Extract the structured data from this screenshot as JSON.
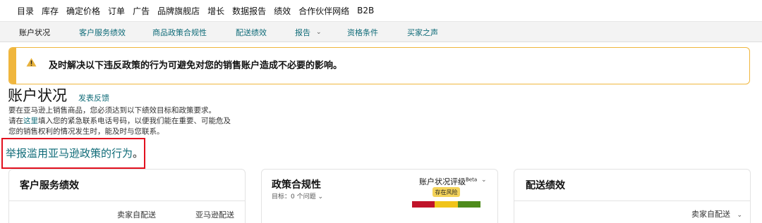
{
  "top_nav": {
    "items": [
      "目录",
      "库存",
      "确定价格",
      "订单",
      "广告",
      "品牌旗舰店",
      "增长",
      "数据报告",
      "绩效",
      "合作伙伴网络",
      "B2B"
    ]
  },
  "sub_nav": {
    "tabs": [
      "账户状况",
      "客户服务绩效",
      "商品政策合规性",
      "配送绩效",
      "报告",
      "资格条件",
      "买家之声"
    ],
    "active_tab": "账户状况"
  },
  "alert": {
    "message": "及时解决以下违反政策的行为可避免对您的销售账户造成不必要的影响。",
    "icon": "warning-icon",
    "colors": {
      "accent": "#f0b63d",
      "icon": "#e7b13b"
    }
  },
  "page": {
    "title": "账户状况",
    "feedback_link": "发表反馈",
    "description": {
      "line1": "要在亚马逊上销售商品，您必须达到以下绩效目标和政策要求。",
      "line2_prefix": "请在",
      "line2_link": "这里",
      "line2_suffix": "填入您的紧急联系电话号码，以便我们能在重要、可能危及",
      "line3": "您的销售权利的情况发生时，能及时与您联系。"
    },
    "report_abuse_link": "举报滥用亚马逊政策的行为",
    "report_abuse_period": "。"
  },
  "cards": {
    "customer_service": {
      "title": "客户服务绩效",
      "columns": [
        "卖家自配送",
        "亚马逊配送"
      ]
    },
    "policy_compliance": {
      "title": "政策合规性",
      "target_label": "目标：",
      "target_value": "0 个问题",
      "rating_label": "账户状况评级",
      "rating_superscript": "Beta",
      "risk_badge": "存在风险",
      "rating_colors": [
        "#c0142a",
        "#f0c419",
        "#4e8b1c"
      ]
    },
    "shipping": {
      "title": "配送绩效",
      "dropdown_label": "卖家自配送"
    }
  },
  "colors": {
    "link": "#0f6b78",
    "highlight_border": "#e2101e"
  }
}
